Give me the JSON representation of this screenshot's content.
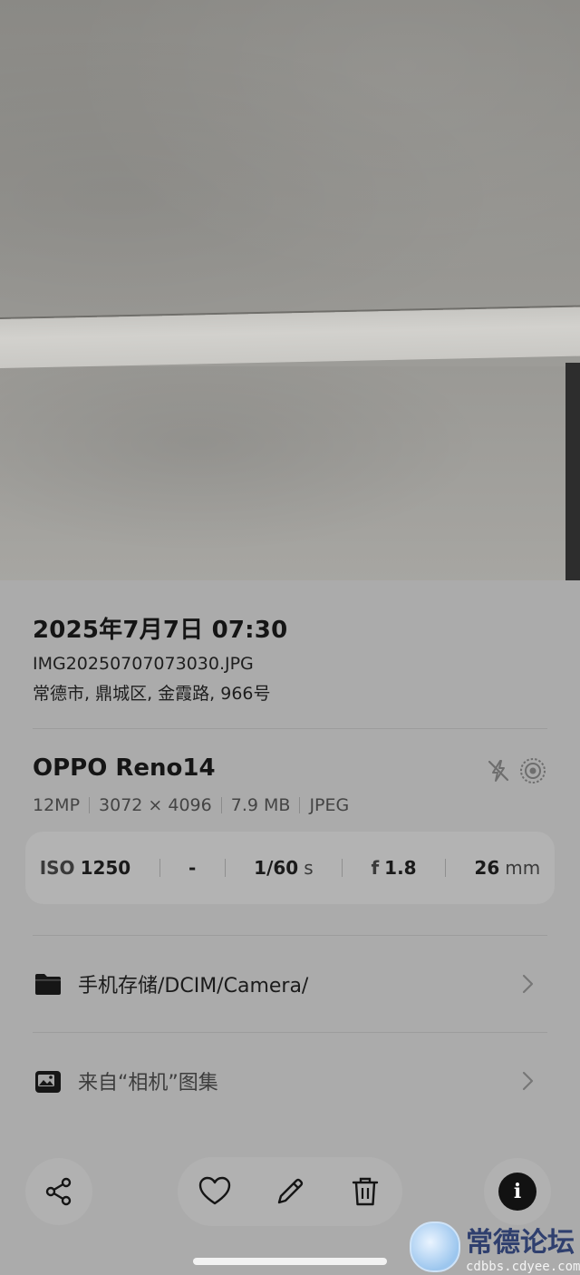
{
  "header": {
    "datetime": "2025年7月7日 07:30",
    "filename": "IMG20250707073030.JPG",
    "location": "常德市, 鼎城区, 金霞路, 966号"
  },
  "device": {
    "model": "OPPO Reno14",
    "specs": [
      "12MP",
      "3072 × 4096",
      "7.9 MB",
      "JPEG"
    ],
    "icons": [
      "flash-off-icon",
      "live-photo-icon"
    ]
  },
  "exif": {
    "iso_label": "ISO",
    "iso_value": "1250",
    "ev": "-",
    "shutter_value": "1/60",
    "shutter_unit": "s",
    "aperture_label": "f",
    "aperture_value": "1.8",
    "focal_value": "26",
    "focal_unit": "mm"
  },
  "rows": [
    {
      "icon": "folder-icon",
      "label": "手机存储/DCIM/Camera/"
    },
    {
      "icon": "album-icon",
      "label": "来自“相机”图集"
    }
  ],
  "toolbar": {
    "icons": [
      "share-icon",
      "heart-icon",
      "edit-icon",
      "delete-icon",
      "info-icon"
    ],
    "info_glyph": "i"
  },
  "watermark": {
    "title": "常德论坛",
    "url": "cdbbs.cdyee.com"
  }
}
